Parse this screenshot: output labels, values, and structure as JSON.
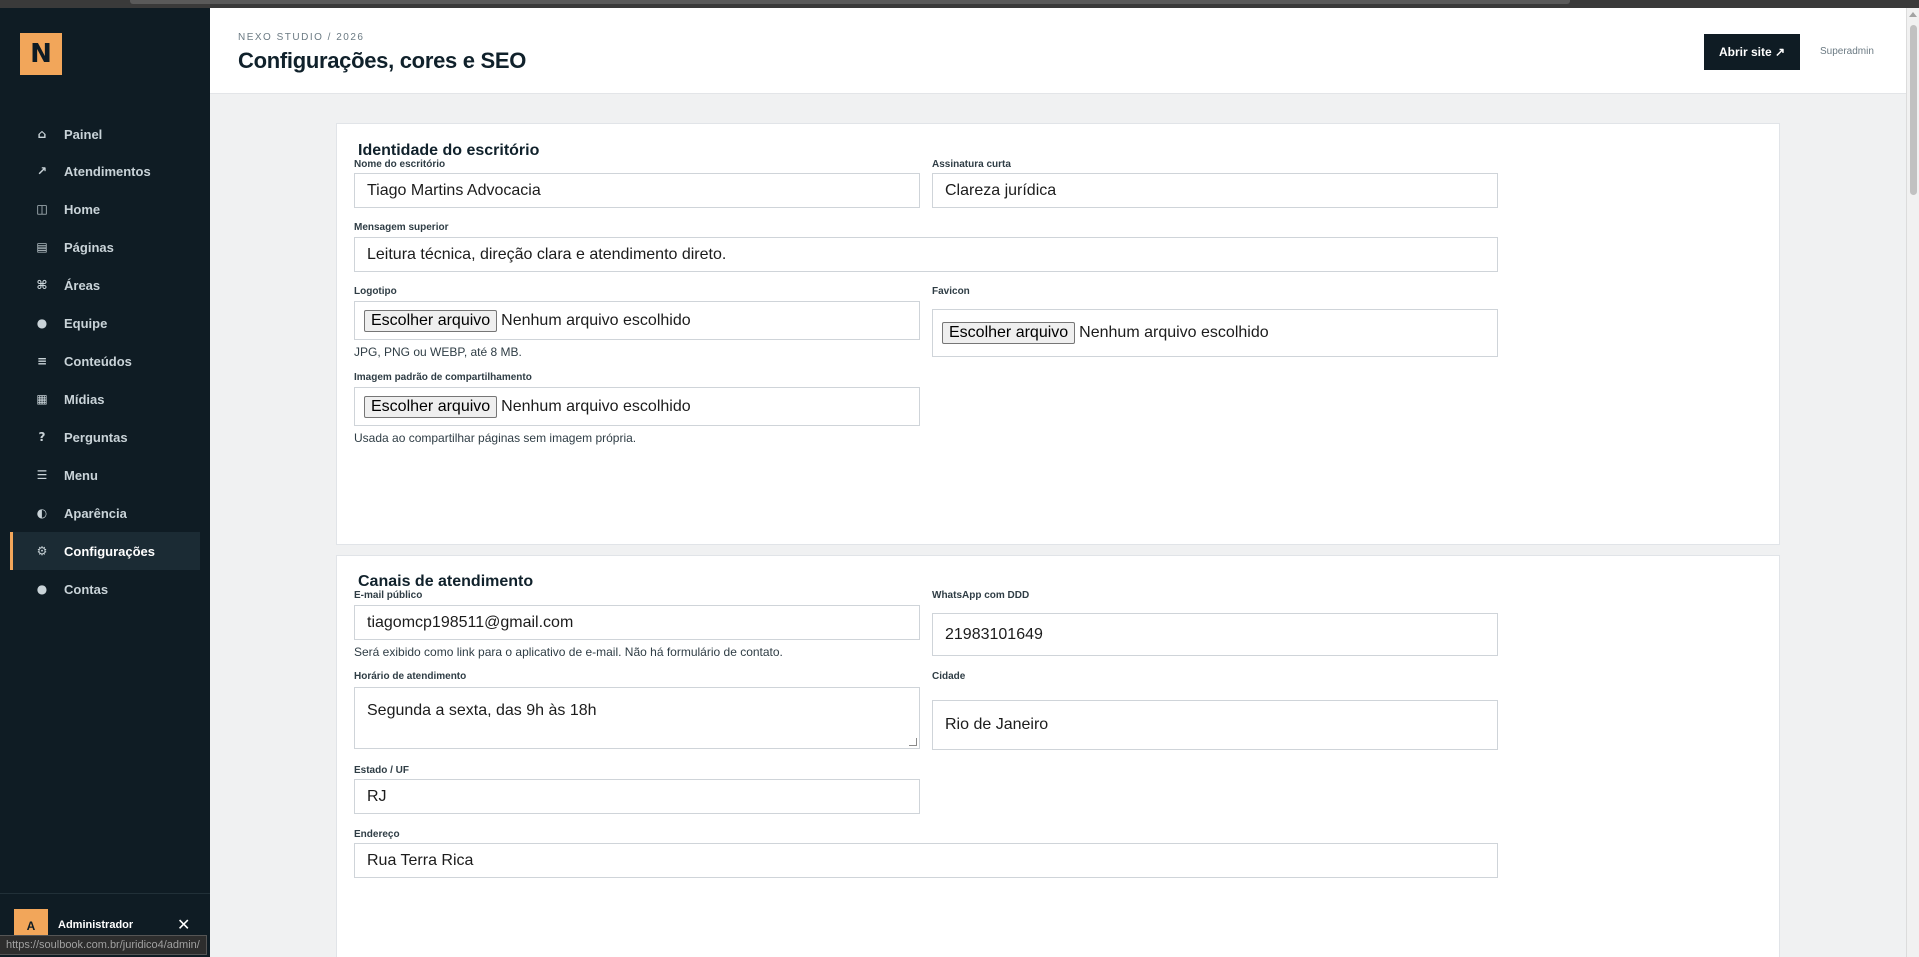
{
  "app": {
    "logo_letter": "N"
  },
  "sidebar": {
    "items": [
      {
        "label": "Painel",
        "icon": "⌂",
        "icon_name": "home-icon"
      },
      {
        "label": "Atendimentos",
        "icon": "↗",
        "icon_name": "arrow-up-right-icon"
      },
      {
        "label": "Home",
        "icon": "◫",
        "icon_name": "layout-icon"
      },
      {
        "label": "Páginas",
        "icon": "▤",
        "icon_name": "pages-icon"
      },
      {
        "label": "Áreas",
        "icon": "⌘",
        "icon_name": "command-icon"
      },
      {
        "label": "Equipe",
        "icon": "●",
        "icon_name": "team-icon"
      },
      {
        "label": "Conteúdos",
        "icon": "≡",
        "icon_name": "content-icon"
      },
      {
        "label": "Mídias",
        "icon": "▦",
        "icon_name": "media-icon"
      },
      {
        "label": "Perguntas",
        "icon": "?",
        "icon_name": "question-icon"
      },
      {
        "label": "Menu",
        "icon": "☰",
        "icon_name": "menu-icon"
      },
      {
        "label": "Aparência",
        "icon": "◐",
        "icon_name": "appearance-icon"
      },
      {
        "label": "Configurações",
        "icon": "⚙",
        "icon_name": "gear-icon"
      },
      {
        "label": "Contas",
        "icon": "●",
        "icon_name": "user-icon"
      }
    ],
    "active_index": 11,
    "user": {
      "avatar_letter": "A",
      "name": "Administrador",
      "close_glyph": "✕"
    }
  },
  "status_url": "https://soulbook.com.br/juridico4/admin/",
  "header": {
    "breadcrumb": "NEXO STUDIO / 2026",
    "title": "Configurações, cores e SEO",
    "open_site_label": "Abrir site ↗",
    "role": "Superadmin"
  },
  "identity": {
    "title": "Identidade do escritório",
    "office_name": {
      "label": "Nome do escritório",
      "value": "Tiago Martins Advocacia"
    },
    "signature": {
      "label": "Assinatura curta",
      "value": "Clareza jurídica"
    },
    "top_message": {
      "label": "Mensagem superior",
      "value": "Leitura técnica, direção clara e atendimento direto."
    },
    "logo": {
      "label": "Logotipo",
      "button": "Escolher arquivo",
      "status": "Nenhum arquivo escolhido",
      "hint": "JPG, PNG ou WEBP, até 8 MB."
    },
    "favicon": {
      "label": "Favicon",
      "button": "Escolher arquivo",
      "status": "Nenhum arquivo escolhido"
    },
    "share_image": {
      "label": "Imagem padrão de compartilhamento",
      "button": "Escolher arquivo",
      "status": "Nenhum arquivo escolhido",
      "hint": "Usada ao compartilhar páginas sem imagem própria."
    }
  },
  "channels": {
    "title": "Canais de atendimento",
    "email": {
      "label": "E-mail público",
      "value": "tiagomcp198511@gmail.com",
      "hint": "Será exibido como link para o aplicativo de e-mail. Não há formulário de contato."
    },
    "whatsapp": {
      "label": "WhatsApp com DDD",
      "value": "21983101649"
    },
    "hours": {
      "label": "Horário de atendimento",
      "value": "Segunda a sexta, das 9h às 18h"
    },
    "city": {
      "label": "Cidade",
      "value": "Rio de Janeiro"
    },
    "state": {
      "label": "Estado / UF",
      "value": "RJ"
    },
    "address": {
      "label": "Endereço",
      "value": "Rua Terra Rica"
    }
  },
  "colors": {
    "accent": "#f2a65a",
    "sidebar_bg": "#0f1c24",
    "page_bg": "#f0f1f2"
  }
}
